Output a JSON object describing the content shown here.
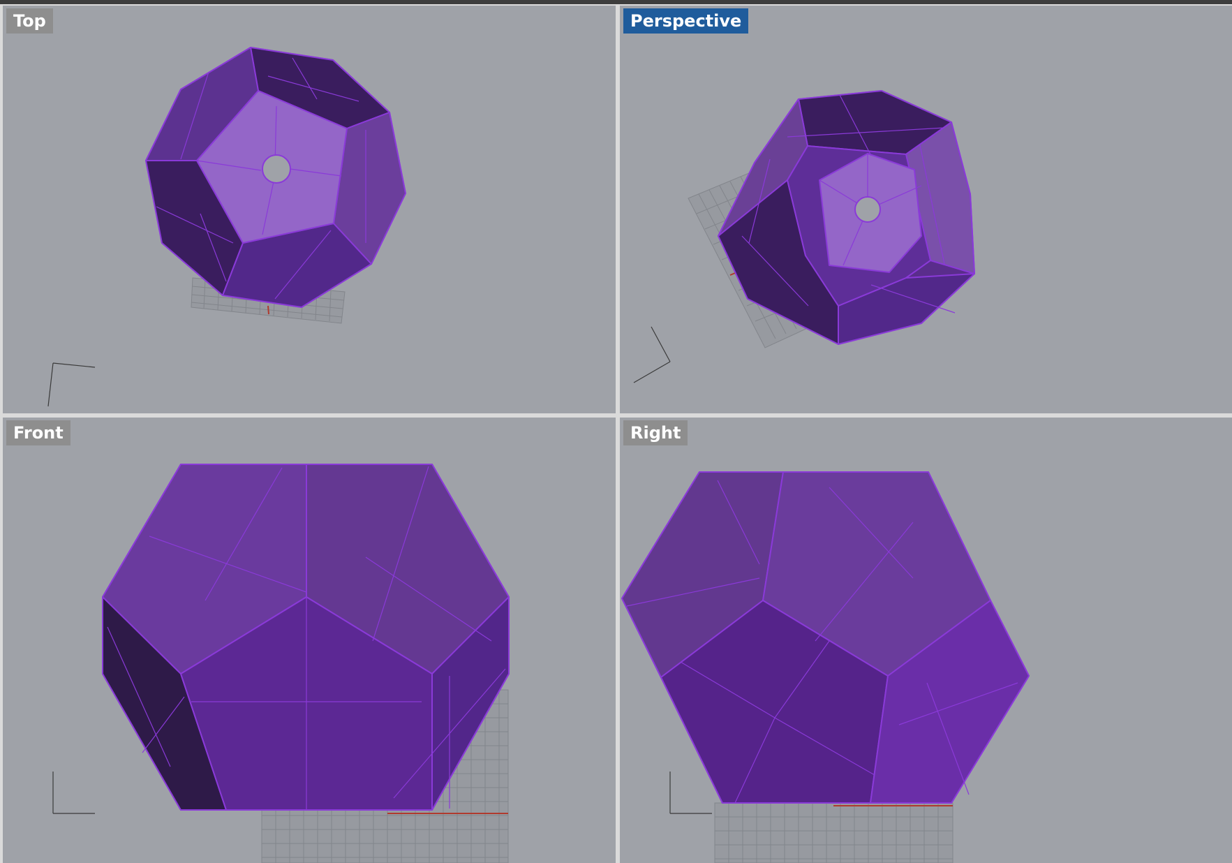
{
  "viewports": {
    "top": {
      "label": "Top"
    },
    "perspective": {
      "label": "Perspective",
      "active": true
    },
    "front": {
      "label": "Front"
    },
    "right": {
      "label": "Right"
    }
  },
  "colors": {
    "viewport_bg": "#9fa2a8",
    "active_label_bg": "#1f5c9c",
    "inactive_label_bg": "#8e8e8e",
    "object_edge": "#8a3ad8",
    "face_light": "#9466c8",
    "face_mid": "#6b3a9e",
    "face_dark": "#3c1f60",
    "grid_line": "#7c7f85",
    "x_axis": "#b03a2e"
  },
  "icons": {
    "axis_gizmo": "axis-gizmo-icon"
  }
}
